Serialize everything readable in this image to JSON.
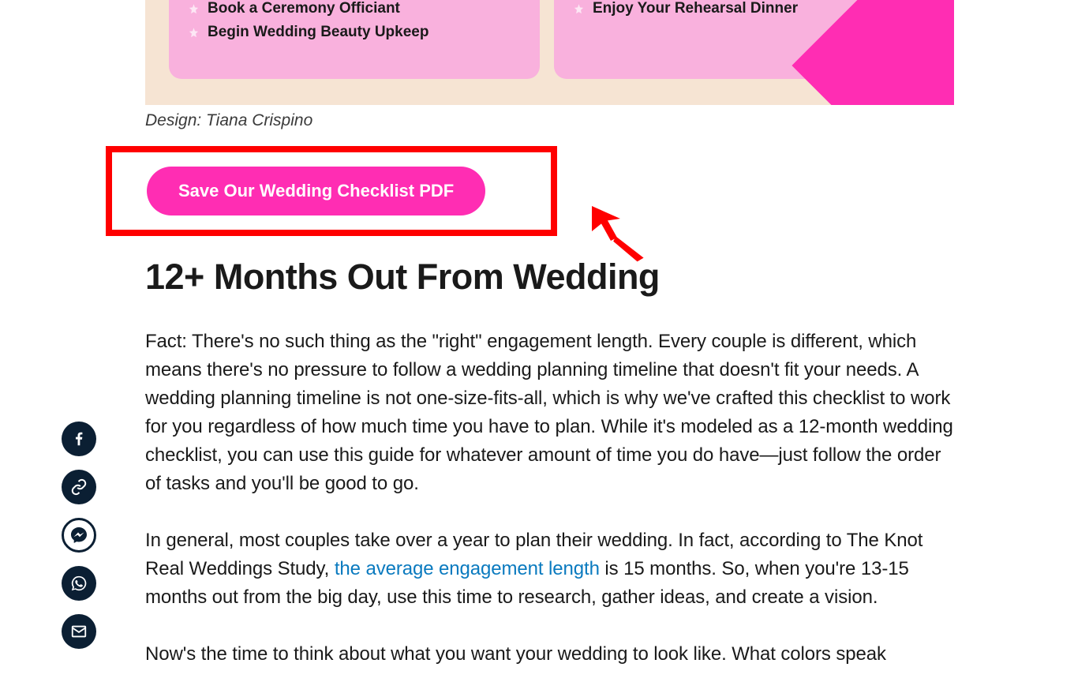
{
  "infographic": {
    "left_items": [
      "Book a Ceremony Officiant",
      "Begin Wedding Beauty Upkeep"
    ],
    "right_items": [
      "Enjoy Your Rehearsal Dinner"
    ]
  },
  "credit": "Design: Tiana Crispino",
  "cta": {
    "save_label": "Save Our Wedding Checklist PDF"
  },
  "section": {
    "title": "12+ Months Out From Wedding",
    "p1": "Fact: There's no such thing as the \"right\" engagement length. Every couple is different, which means there's no pressure to follow a wedding planning timeline that doesn't fit your needs. A wedding planning timeline is not one-size-fits-all, which is why we've crafted this checklist to work for you regardless of how much time you have to plan. While it's modeled as a 12-month wedding checklist, you can use this guide for whatever amount of time you do have—just follow the order of tasks and you'll be good to go.",
    "p2_a": "In general, most couples take over a year to plan their wedding. In fact, according to The Knot Real Weddings Study, ",
    "p2_link": "the average engagement length",
    "p2_b": " is 15 months. So, when you're 13-15 months out from the big day, use this time to research, gather ideas, and create a vision.",
    "p3": "Now's the time to think about what you want your wedding to look like. What colors speak"
  },
  "share": {
    "facebook": "facebook",
    "link": "copy-link",
    "messenger": "messenger",
    "whatsapp": "whatsapp",
    "email": "email"
  }
}
